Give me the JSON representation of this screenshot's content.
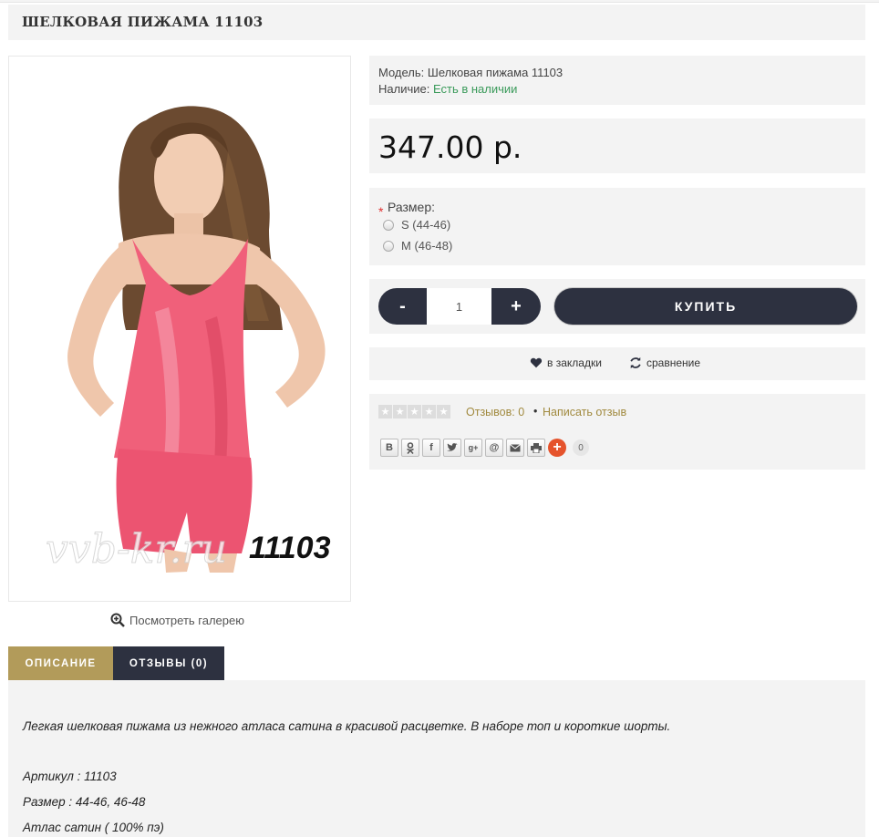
{
  "product": {
    "title": "ШЕЛКОВАЯ ПИЖАМА 11103",
    "model_label": "Модель:",
    "model_value": "Шелковая пижама 11103",
    "stock_label": "Наличие:",
    "stock_value": "Есть в наличии",
    "price": "347.00 р.",
    "image_watermark": "vvb-kr.ru",
    "image_number": "11103"
  },
  "gallery_link": "Посмотреть галерею",
  "options": {
    "required_mark": "*",
    "label": "Размер:",
    "choices": [
      "S (44-46)",
      "M (46-48)"
    ]
  },
  "cart": {
    "minus": "-",
    "plus": "+",
    "quantity": "1",
    "buy_label": "КУПИТЬ"
  },
  "actions": {
    "wishlist": "в закладки",
    "compare": "сравнение"
  },
  "reviews": {
    "count_text": "Отзывов: 0",
    "separator": "•",
    "write_text": "Написать отзыв",
    "rating": 0,
    "max_rating": 5
  },
  "share": {
    "buttons": [
      "В",
      "ok",
      "f",
      "t",
      "g+",
      "@",
      "mail",
      "print"
    ],
    "add": "+",
    "count": "0"
  },
  "tabs": [
    {
      "label": "ОПИСАНИЕ",
      "active": true
    },
    {
      "label": "ОТЗЫВЫ (0)",
      "active": false
    }
  ],
  "description": {
    "intro": "Легкая шелковая пижама из нежного атласа сатина в красивой расцветке. В наборе топ и короткие шорты.",
    "article": "Артикул : 11103",
    "size": "Размер :  44-46, 46-48",
    "material": "Атлас сатин ( 100% пэ)"
  },
  "colors": {
    "dark": "#2d3140",
    "gold": "#b29b5a",
    "panel_bg": "#f3f3f3",
    "stock_green": "#3a9a5a",
    "link_gold": "#a18a3f",
    "pajama_pink": "#f0607a"
  }
}
